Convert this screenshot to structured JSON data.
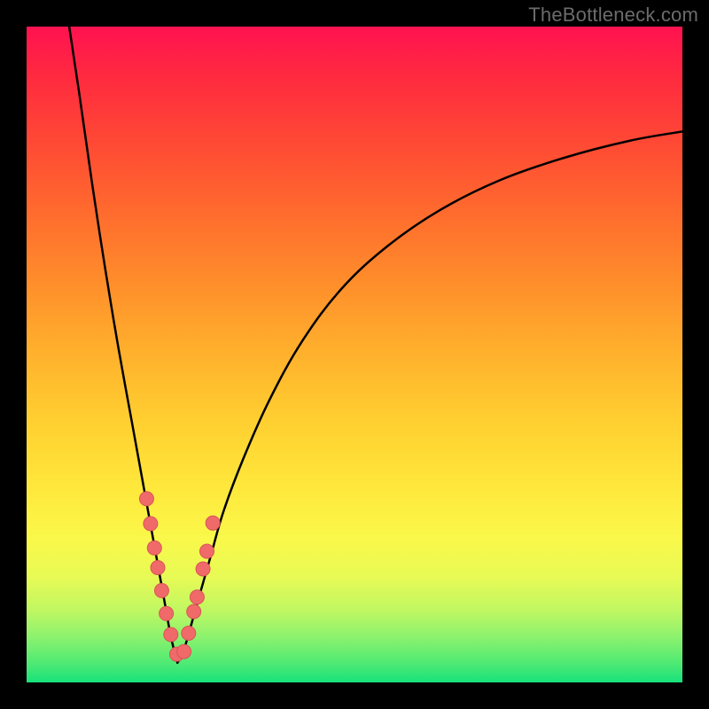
{
  "watermark": "TheBottleneck.com",
  "colors": {
    "curve_stroke": "#000000",
    "marker_fill": "#f06a6a",
    "marker_stroke": "#d85555",
    "background": "#000000"
  },
  "chart_data": {
    "type": "line",
    "title": "",
    "xlabel": "",
    "ylabel": "",
    "xlim": [
      0,
      100
    ],
    "ylim": [
      0,
      100
    ],
    "grid": false,
    "legend": false,
    "series": [
      {
        "name": "left-branch",
        "x": [
          6.5,
          8,
          10,
          12,
          14,
          16,
          18,
          19,
          20,
          21,
          22,
          23
        ],
        "y": [
          100,
          90,
          76,
          63,
          51,
          40,
          29,
          23.5,
          18,
          12.5,
          7,
          3
        ]
      },
      {
        "name": "right-branch",
        "x": [
          23,
          24,
          26,
          28,
          30,
          33,
          37,
          42,
          48,
          55,
          63,
          72,
          82,
          92,
          100
        ],
        "y": [
          3,
          5,
          12,
          19,
          26,
          34,
          43,
          52,
          60,
          66.5,
          72,
          76.5,
          80,
          82.6,
          84
        ]
      }
    ],
    "markers": {
      "name": "datapoints",
      "x": [
        18.3,
        18.9,
        19.5,
        20.0,
        20.6,
        21.3,
        22.0,
        22.9,
        24.0,
        24.7,
        25.5,
        26.0,
        26.9,
        27.5,
        28.4
      ],
      "y": [
        28.0,
        24.2,
        20.5,
        17.5,
        14.0,
        10.5,
        7.3,
        4.3,
        4.7,
        7.5,
        10.8,
        13.0,
        17.3,
        20.0,
        24.3
      ]
    },
    "annotations": []
  }
}
